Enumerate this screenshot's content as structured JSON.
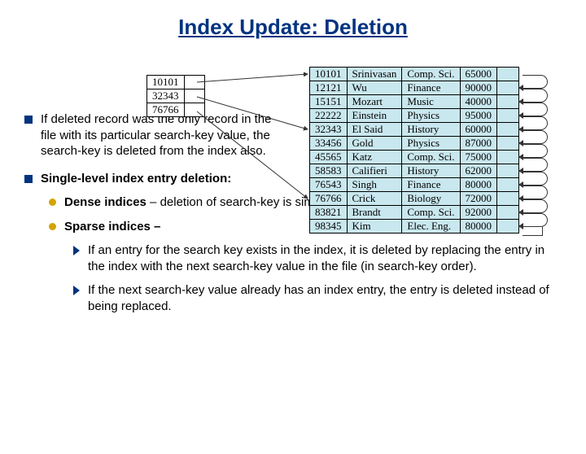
{
  "title": "Index Update:  Deletion",
  "para1": "If deleted record was the only record in the file with its particular search-key value, the search-key is deleted from the index also.",
  "para2_head": "Single-level index entry deletion:",
  "dense_head": "Dense indices",
  "dense_text": " – deletion of search-key is similar to file record deletion.",
  "sparse_head": "Sparse indices –",
  "sparse_a": "If an entry for the search key exists in the index, it is deleted by replacing the entry in the index with the next search-key value in the file (in search-key order).",
  "sparse_b": "If the next search-key value already has an index entry, the entry is deleted instead of being replaced.",
  "index_keys": [
    "10101",
    "32343",
    "76766"
  ],
  "records": [
    [
      "10101",
      "Srinivasan",
      "Comp. Sci.",
      "65000"
    ],
    [
      "12121",
      "Wu",
      "Finance",
      "90000"
    ],
    [
      "15151",
      "Mozart",
      "Music",
      "40000"
    ],
    [
      "22222",
      "Einstein",
      "Physics",
      "95000"
    ],
    [
      "32343",
      "El Said",
      "History",
      "60000"
    ],
    [
      "33456",
      "Gold",
      "Physics",
      "87000"
    ],
    [
      "45565",
      "Katz",
      "Comp. Sci.",
      "75000"
    ],
    [
      "58583",
      "Califieri",
      "History",
      "62000"
    ],
    [
      "76543",
      "Singh",
      "Finance",
      "80000"
    ],
    [
      "76766",
      "Crick",
      "Biology",
      "72000"
    ],
    [
      "83821",
      "Brandt",
      "Comp. Sci.",
      "92000"
    ],
    [
      "98345",
      "Kim",
      "Elec. Eng.",
      "80000"
    ]
  ]
}
